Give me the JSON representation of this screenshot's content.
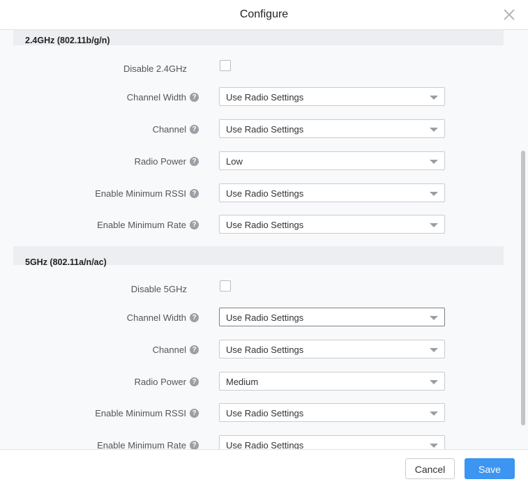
{
  "dialog": {
    "title": "Configure",
    "cancel_label": "Cancel",
    "save_label": "Save"
  },
  "band_24": {
    "heading": "2.4GHz (802.11b/g/n)",
    "disable_label": "Disable 2.4GHz",
    "disable_checked": false,
    "fields": [
      {
        "label": "Channel Width",
        "value": "Use Radio Settings"
      },
      {
        "label": "Channel",
        "value": "Use Radio Settings"
      },
      {
        "label": "Radio Power",
        "value": "Low"
      },
      {
        "label": "Enable Minimum RSSI",
        "value": "Use Radio Settings"
      },
      {
        "label": "Enable Minimum Rate",
        "value": "Use Radio Settings"
      }
    ]
  },
  "band_5": {
    "heading": "5GHz (802.11a/n/ac)",
    "disable_label": "Disable 5GHz",
    "disable_checked": false,
    "fields": [
      {
        "label": "Channel Width",
        "value": "Use Radio Settings"
      },
      {
        "label": "Channel",
        "value": "Use Radio Settings"
      },
      {
        "label": "Radio Power",
        "value": "Medium"
      },
      {
        "label": "Enable Minimum RSSI",
        "value": "Use Radio Settings"
      },
      {
        "label": "Enable Minimum Rate",
        "value": "Use Radio Settings"
      }
    ]
  },
  "icons": {
    "help": "?",
    "close": "close-icon",
    "dropdown": "caret-down-icon"
  },
  "colors": {
    "primary": "#3c95f0",
    "section_bg": "#eceef1",
    "body_bg": "#f8f9fb"
  }
}
